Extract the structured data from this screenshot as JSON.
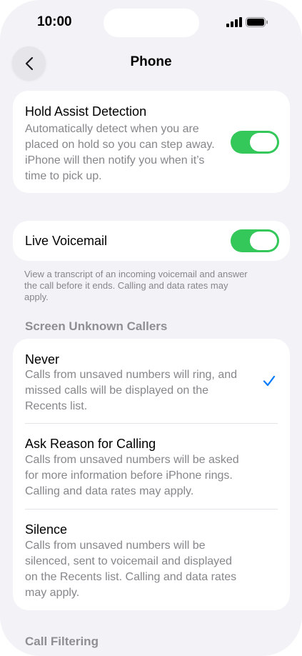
{
  "status_bar": {
    "time": "10:00"
  },
  "nav": {
    "title": "Phone",
    "back_icon": "chevron-left-icon"
  },
  "hold_assist": {
    "title": "Hold Assist Detection",
    "description_lines": [
      "Automatically detect when you are",
      "placed on hold so you can step away.",
      "iPhone will then notify you when it’s",
      "time to pick up."
    ],
    "enabled": true
  },
  "live_voicemail": {
    "title": "Live Voicemail",
    "enabled": true,
    "footnote_lines": [
      "View a transcript of an incoming voicemail and answer",
      "the call before it ends. Calling and data rates may",
      "apply."
    ]
  },
  "screen_unknown_callers": {
    "header": "Screen Unknown Callers",
    "options": [
      {
        "title": "Never",
        "description_lines": [
          "Calls from unsaved numbers will ring, and",
          "missed calls will be displayed on the",
          "Recents list."
        ],
        "selected": true
      },
      {
        "title": "Ask Reason for Calling",
        "description_lines": [
          "Calls from unsaved numbers will be asked",
          "for more information before iPhone rings.",
          "Calling and data rates may apply."
        ],
        "selected": false
      },
      {
        "title": "Silence",
        "description_lines": [
          "Calls from unsaved numbers will be",
          "silenced, sent to voicemail and displayed",
          "on the Recents list. Calling and data rates",
          "may apply."
        ],
        "selected": false
      }
    ]
  },
  "call_filtering": {
    "header": "Call Filtering"
  },
  "colors": {
    "toggle_on": "#34c759",
    "accent": "#007aff",
    "background": "#f2f2f7",
    "secondary_text": "#86868b"
  }
}
